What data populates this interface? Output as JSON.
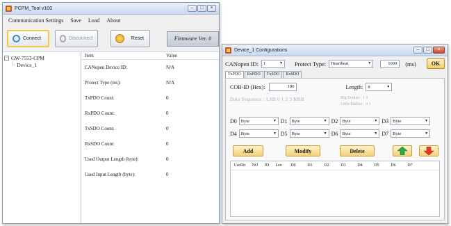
{
  "main_window": {
    "title": "PCPM_Tool v100",
    "menu": [
      "Communication Settings",
      "Save",
      "Load",
      "About"
    ],
    "toolbar": {
      "connect": "Connect",
      "disconnect": "Disconnect",
      "reset": "Reset",
      "firmware": "Firmware Ver. 0"
    },
    "tree": {
      "root": "GW-7553-CPM",
      "child": "Device_1"
    },
    "props": {
      "headers": [
        "Item",
        "Value"
      ],
      "rows": [
        {
          "item": "CANopen Device ID:",
          "value": "N/A"
        },
        {
          "item": "Protect Type (ms):",
          "value": "N/A"
        },
        {
          "item": "TxPDO Count:",
          "value": "0"
        },
        {
          "item": "RxPDO Count:",
          "value": "0"
        },
        {
          "item": "TxSDO Count:",
          "value": "0"
        },
        {
          "item": "RxSDO Count:",
          "value": "0"
        },
        {
          "item": "Used Output Length (byte):",
          "value": "0"
        },
        {
          "item": "Used Input Length (byte):",
          "value": "0"
        }
      ]
    }
  },
  "device_window": {
    "title": "Device_1 Configurations",
    "canopen_id_label": "CANopen ID:",
    "canopen_id_value": "1",
    "protect_type_label": "Protect Type:",
    "protect_type_value": "Heartbeat",
    "protect_ms_value": "1000",
    "protect_unit": "(ms)",
    "ok": "OK",
    "tabs": [
      "TxPDO",
      "RxPDO",
      "TxSDO",
      "RxSDO"
    ],
    "cob_label": "COB-ID (Hex):",
    "cob_value": "180",
    "length_label": "Length:",
    "length_value": "8",
    "data_sequence": "Data Sequence : LSB  0  1  2  3  MSB",
    "big_endian": "Big Endian :  1  0",
    "little_endian": "Little Endian :  0  1",
    "data_rows": [
      [
        {
          "label": "D0",
          "value": "Byte"
        },
        {
          "label": "D1",
          "value": "Byte"
        },
        {
          "label": "D2",
          "value": "Byte"
        },
        {
          "label": "D3",
          "value": "Byte"
        }
      ],
      [
        {
          "label": "D4",
          "value": "Byte"
        },
        {
          "label": "D5",
          "value": "Byte"
        },
        {
          "label": "D6",
          "value": "Byte"
        },
        {
          "label": "D7",
          "value": "Byte"
        }
      ]
    ],
    "buttons": {
      "add": "Add",
      "modify": "Modify",
      "delete": "Delete"
    },
    "grid_headers": [
      "UseRtr",
      "NO",
      "ID",
      "Len",
      "D0",
      "D1",
      "D2",
      "D3",
      "D4",
      "D5",
      "D6",
      "D7"
    ]
  },
  "icons": {
    "connect": "plug-icon",
    "disconnect": "unplug-icon",
    "reset": "reset-icon",
    "move_up": "green-up-arrow-icon",
    "move_down": "red-down-arrow-icon"
  }
}
